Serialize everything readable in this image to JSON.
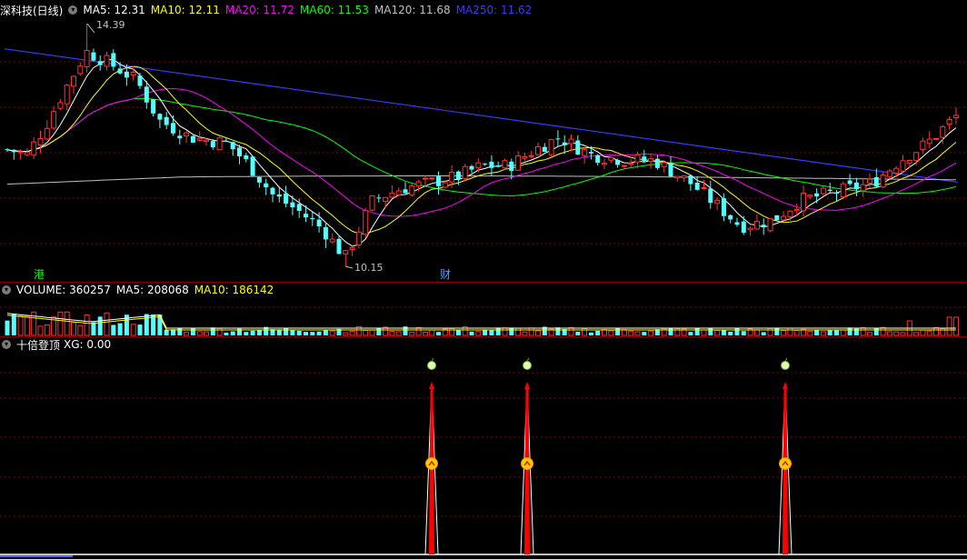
{
  "panel_main": {
    "title": "深科技(日线)",
    "ma": [
      {
        "label": "MA5: 12.31",
        "color": "#ffffff"
      },
      {
        "label": "MA10: 12.11",
        "color": "#ffff00"
      },
      {
        "label": "MA20: 11.72",
        "color": "#ff00ff"
      },
      {
        "label": "MA60: 11.53",
        "color": "#00ff00"
      },
      {
        "label": "MA120: 11.68",
        "color": "#c0c0c0"
      },
      {
        "label": "MA250: 11.62",
        "color": "#3a3aff"
      }
    ],
    "high_label": "14.39",
    "low_label": "10.15",
    "tag_gang": "港",
    "tag_cai": "财"
  },
  "panel_volume": {
    "title": "VOLUME: 360257",
    "ma5": "MA5: 208068",
    "ma10": "MA10: 186142"
  },
  "panel_indicator": {
    "title": "十倍登顶",
    "xg": "XG: 0.00"
  },
  "colors": {
    "up": "#ff3333",
    "down": "#55ffff",
    "grid": "#8a0000",
    "signal": "#ff0000",
    "ma250": "#3a3aff"
  },
  "chart_data": {
    "type": "candlestick",
    "price_range": [
      10.15,
      14.39
    ],
    "signals_count": 3
  }
}
